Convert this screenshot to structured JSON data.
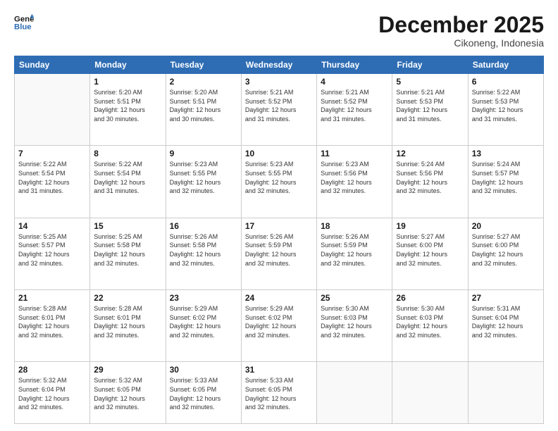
{
  "logo": {
    "line1": "General",
    "line2": "Blue"
  },
  "title": "December 2025",
  "subtitle": "Cikoneng, Indonesia",
  "header_days": [
    "Sunday",
    "Monday",
    "Tuesday",
    "Wednesday",
    "Thursday",
    "Friday",
    "Saturday"
  ],
  "weeks": [
    [
      {
        "day": "",
        "info": ""
      },
      {
        "day": "1",
        "info": "Sunrise: 5:20 AM\nSunset: 5:51 PM\nDaylight: 12 hours\nand 30 minutes."
      },
      {
        "day": "2",
        "info": "Sunrise: 5:20 AM\nSunset: 5:51 PM\nDaylight: 12 hours\nand 30 minutes."
      },
      {
        "day": "3",
        "info": "Sunrise: 5:21 AM\nSunset: 5:52 PM\nDaylight: 12 hours\nand 31 minutes."
      },
      {
        "day": "4",
        "info": "Sunrise: 5:21 AM\nSunset: 5:52 PM\nDaylight: 12 hours\nand 31 minutes."
      },
      {
        "day": "5",
        "info": "Sunrise: 5:21 AM\nSunset: 5:53 PM\nDaylight: 12 hours\nand 31 minutes."
      },
      {
        "day": "6",
        "info": "Sunrise: 5:22 AM\nSunset: 5:53 PM\nDaylight: 12 hours\nand 31 minutes."
      }
    ],
    [
      {
        "day": "7",
        "info": "Sunrise: 5:22 AM\nSunset: 5:54 PM\nDaylight: 12 hours\nand 31 minutes."
      },
      {
        "day": "8",
        "info": "Sunrise: 5:22 AM\nSunset: 5:54 PM\nDaylight: 12 hours\nand 31 minutes."
      },
      {
        "day": "9",
        "info": "Sunrise: 5:23 AM\nSunset: 5:55 PM\nDaylight: 12 hours\nand 32 minutes."
      },
      {
        "day": "10",
        "info": "Sunrise: 5:23 AM\nSunset: 5:55 PM\nDaylight: 12 hours\nand 32 minutes."
      },
      {
        "day": "11",
        "info": "Sunrise: 5:23 AM\nSunset: 5:56 PM\nDaylight: 12 hours\nand 32 minutes."
      },
      {
        "day": "12",
        "info": "Sunrise: 5:24 AM\nSunset: 5:56 PM\nDaylight: 12 hours\nand 32 minutes."
      },
      {
        "day": "13",
        "info": "Sunrise: 5:24 AM\nSunset: 5:57 PM\nDaylight: 12 hours\nand 32 minutes."
      }
    ],
    [
      {
        "day": "14",
        "info": "Sunrise: 5:25 AM\nSunset: 5:57 PM\nDaylight: 12 hours\nand 32 minutes."
      },
      {
        "day": "15",
        "info": "Sunrise: 5:25 AM\nSunset: 5:58 PM\nDaylight: 12 hours\nand 32 minutes."
      },
      {
        "day": "16",
        "info": "Sunrise: 5:26 AM\nSunset: 5:58 PM\nDaylight: 12 hours\nand 32 minutes."
      },
      {
        "day": "17",
        "info": "Sunrise: 5:26 AM\nSunset: 5:59 PM\nDaylight: 12 hours\nand 32 minutes."
      },
      {
        "day": "18",
        "info": "Sunrise: 5:26 AM\nSunset: 5:59 PM\nDaylight: 12 hours\nand 32 minutes."
      },
      {
        "day": "19",
        "info": "Sunrise: 5:27 AM\nSunset: 6:00 PM\nDaylight: 12 hours\nand 32 minutes."
      },
      {
        "day": "20",
        "info": "Sunrise: 5:27 AM\nSunset: 6:00 PM\nDaylight: 12 hours\nand 32 minutes."
      }
    ],
    [
      {
        "day": "21",
        "info": "Sunrise: 5:28 AM\nSunset: 6:01 PM\nDaylight: 12 hours\nand 32 minutes."
      },
      {
        "day": "22",
        "info": "Sunrise: 5:28 AM\nSunset: 6:01 PM\nDaylight: 12 hours\nand 32 minutes."
      },
      {
        "day": "23",
        "info": "Sunrise: 5:29 AM\nSunset: 6:02 PM\nDaylight: 12 hours\nand 32 minutes."
      },
      {
        "day": "24",
        "info": "Sunrise: 5:29 AM\nSunset: 6:02 PM\nDaylight: 12 hours\nand 32 minutes."
      },
      {
        "day": "25",
        "info": "Sunrise: 5:30 AM\nSunset: 6:03 PM\nDaylight: 12 hours\nand 32 minutes."
      },
      {
        "day": "26",
        "info": "Sunrise: 5:30 AM\nSunset: 6:03 PM\nDaylight: 12 hours\nand 32 minutes."
      },
      {
        "day": "27",
        "info": "Sunrise: 5:31 AM\nSunset: 6:04 PM\nDaylight: 12 hours\nand 32 minutes."
      }
    ],
    [
      {
        "day": "28",
        "info": "Sunrise: 5:32 AM\nSunset: 6:04 PM\nDaylight: 12 hours\nand 32 minutes."
      },
      {
        "day": "29",
        "info": "Sunrise: 5:32 AM\nSunset: 6:05 PM\nDaylight: 12 hours\nand 32 minutes."
      },
      {
        "day": "30",
        "info": "Sunrise: 5:33 AM\nSunset: 6:05 PM\nDaylight: 12 hours\nand 32 minutes."
      },
      {
        "day": "31",
        "info": "Sunrise: 5:33 AM\nSunset: 6:05 PM\nDaylight: 12 hours\nand 32 minutes."
      },
      {
        "day": "",
        "info": ""
      },
      {
        "day": "",
        "info": ""
      },
      {
        "day": "",
        "info": ""
      }
    ]
  ]
}
